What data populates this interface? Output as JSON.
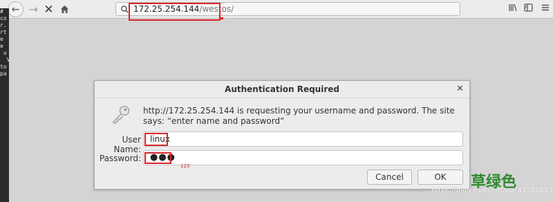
{
  "toolbar": {
    "back_icon": "arrow-left-icon",
    "forward_icon": "arrow-right-icon",
    "stop_icon": "close-icon",
    "home_icon": "home-icon",
    "url_host": "172.25.254.144",
    "url_path": "/westos/",
    "library_icon": "library-icon",
    "sidebar_icon": "sidebar-icon",
    "menu_icon": "hamburger-menu-icon"
  },
  "terminal": {
    "lines": [
      "#",
      "co",
      "r.",
      "rt",
      "e",
      "e",
      " u",
      "  V",
      "",
      "",
      "to",
      "",
      "pa"
    ]
  },
  "dialog": {
    "title": "Authentication Required",
    "message": "http://172.25.254.144 is requesting your username and password. The site says: “enter name and password”",
    "username_label": "User Name:",
    "username_value": "linux",
    "password_label": "Password:",
    "password_value": "●●●",
    "cancel_label": "Cancel",
    "ok_label": "OK"
  },
  "annotation": {
    "password_note": "123",
    "color": "#d9262b"
  },
  "watermark": {
    "brand": "草绿色",
    "url": "https://blog.csdn.net/qq_41582883"
  }
}
